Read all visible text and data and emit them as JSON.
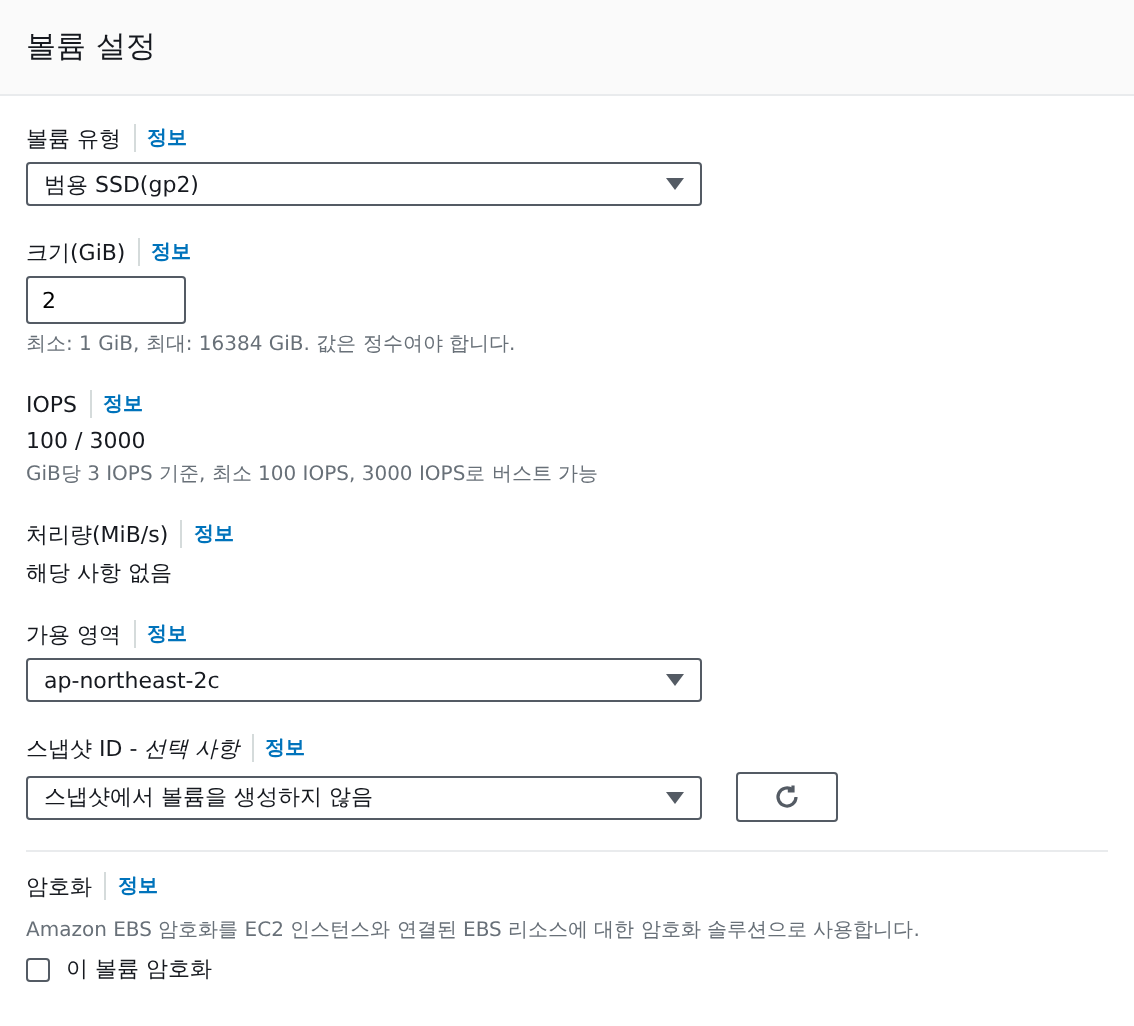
{
  "header": {
    "title": "볼륨 설정"
  },
  "fields": [
    {
      "kind": "select",
      "label": "볼륨 유형",
      "info": "정보",
      "value": "범용 SSD(gp2)"
    },
    {
      "kind": "input",
      "label": "크기(GiB)",
      "info": "정보",
      "value": "2",
      "hint": "최소: 1 GiB, 최대: 16384 GiB. 값은 정수여야 합니다."
    },
    {
      "kind": "readonly",
      "label": "IOPS",
      "info": "정보",
      "value": "100 / 3000",
      "hint": "GiB당 3 IOPS 기준, 최소 100 IOPS, 3000 IOPS로 버스트 가능"
    },
    {
      "kind": "readonly",
      "label": "처리량(MiB/s)",
      "info": "정보",
      "value": "해당 사항 없음"
    },
    {
      "kind": "select",
      "label": "가용 영역",
      "info": "정보",
      "value": "ap-northeast-2c"
    },
    {
      "kind": "select",
      "label": "스냅샷 ID - *선택 사항*",
      "info": "정보",
      "value": "스냅샷에서 볼륨을 생성하지 않음",
      "refresh": true
    },
    {
      "kind": "checkbox",
      "label": "암호화",
      "info": "정보",
      "hint": "Amazon EBS 암호화를 EC2 인스턴스와 연결된 EBS 리소스에 대한 암호화 솔루션으로 사용합니다.",
      "option": "이 볼륨 암호화",
      "checked": false
    }
  ]
}
